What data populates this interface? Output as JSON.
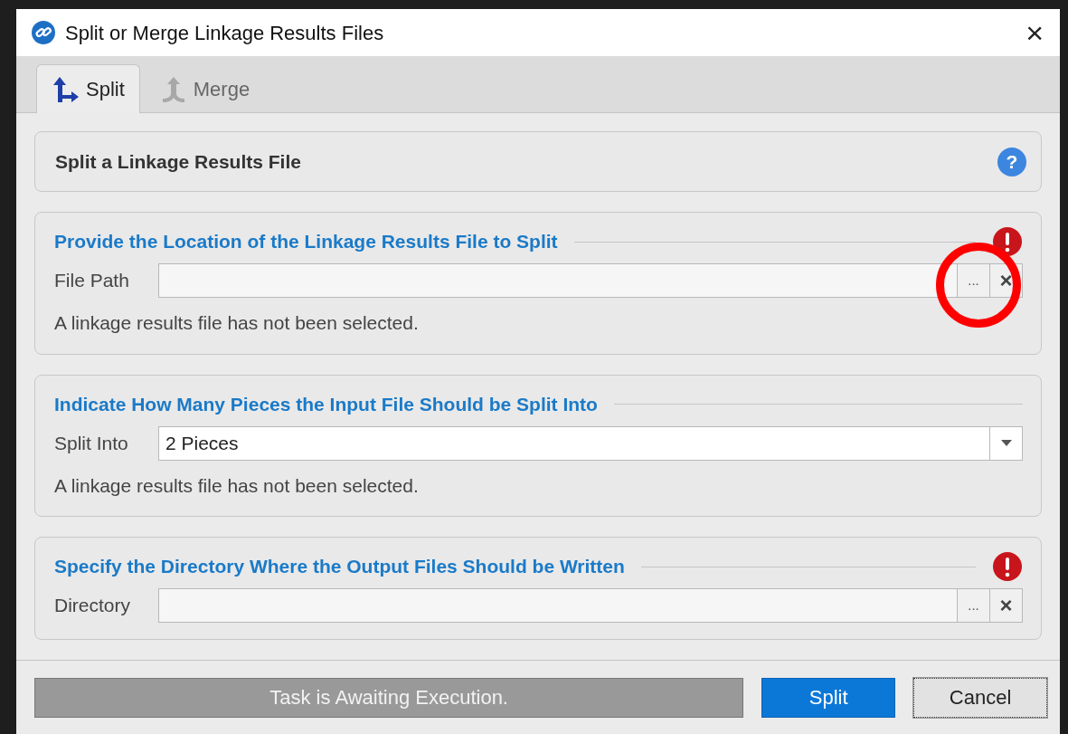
{
  "window": {
    "title": "Split or Merge Linkage Results Files",
    "close": "×"
  },
  "tabs": [
    {
      "label": "Split",
      "kind": "split",
      "selected": true
    },
    {
      "label": "Merge",
      "kind": "merge",
      "selected": false
    }
  ],
  "header": {
    "title": "Split a Linkage Results File",
    "help": "?"
  },
  "sections": [
    {
      "kind": "path",
      "title": "Provide the Location of the Linkage Results File to Split",
      "error": true,
      "label": "File Path",
      "browse": "...",
      "clear": "×",
      "message": "A linkage results file has not been selected."
    },
    {
      "kind": "select",
      "title": "Indicate How Many Pieces the Input File Should be Split Into",
      "error": false,
      "label": "Split Into",
      "value": "2 Pieces",
      "message": "A linkage results file has not been selected."
    },
    {
      "kind": "path",
      "title": "Specify the Directory Where the Output Files Should be Written",
      "error": true,
      "label": "Directory",
      "browse": "...",
      "clear": "×"
    }
  ],
  "status": "Task is Awaiting Execution.",
  "buttons": [
    {
      "label": "Split",
      "kind": "primary"
    },
    {
      "label": "Cancel",
      "kind": "default"
    }
  ],
  "annotations": [
    {
      "kind": "circle"
    }
  ]
}
